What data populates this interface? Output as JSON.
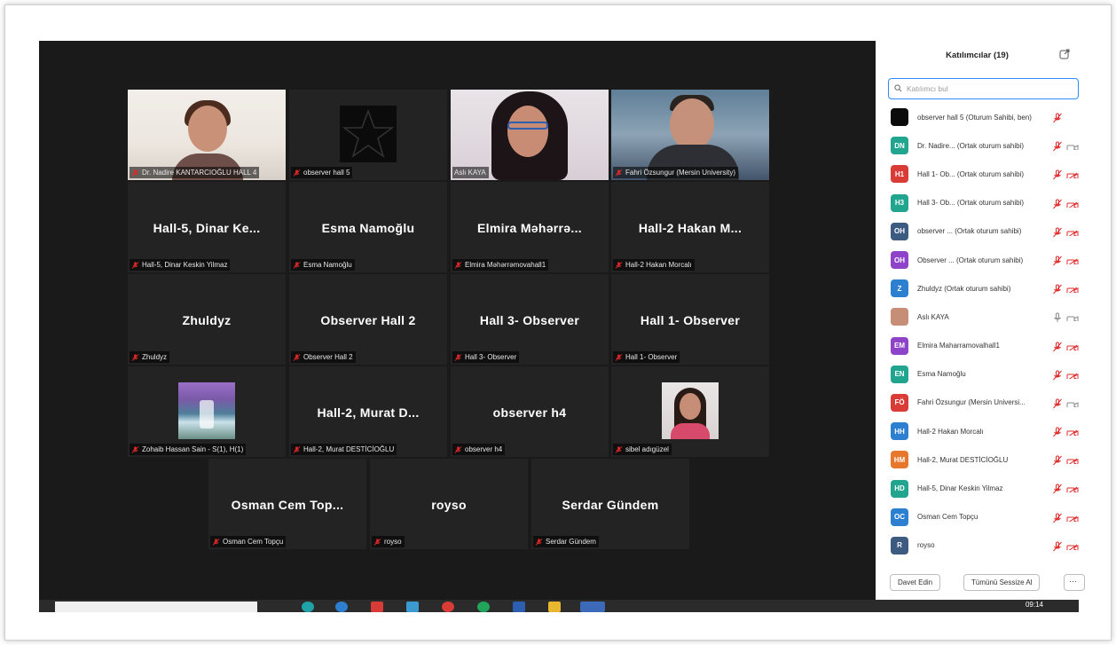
{
  "colors": {
    "video_bg": "#1a1a1a",
    "tile_bg": "#232323",
    "active_speaker": "#c7d33a",
    "muted_red": "#e02828",
    "accent_blue": "#2d8cff"
  },
  "video_tiles": [
    {
      "label": "Dr. Nadire KANTARCIOĞLU HALL 4",
      "big_name": "",
      "kind": "photo1"
    },
    {
      "label": "observer hall 5",
      "big_name": "",
      "kind": "star"
    },
    {
      "label": "Aslı KAYA",
      "big_name": "",
      "kind": "photo3"
    },
    {
      "label": "Fahri Özsungur (Mersin University)",
      "big_name": "",
      "kind": "photo4",
      "active": true
    },
    {
      "label": "Hall-5, Dinar Keskin Yilmaz",
      "big_name": "Hall-5, Dinar Ke..."
    },
    {
      "label": "Esma Namoğlu",
      "big_name": "Esma Namoğlu"
    },
    {
      "label": "Elmira Məhərrəmovahall1",
      "big_name": "Elmira Məhərrə..."
    },
    {
      "label": "Hall-2 Hakan Morcalı",
      "big_name": "Hall-2 Hakan M..."
    },
    {
      "label": "Zhuldyz",
      "big_name": "Zhuldyz"
    },
    {
      "label": "Observer Hall 2",
      "big_name": "Observer Hall 2"
    },
    {
      "label": "Hall 3- Observer",
      "big_name": "Hall 3- Observer"
    },
    {
      "label": "Hall 1- Observer",
      "big_name": "Hall 1- Observer"
    },
    {
      "label": "Zohaib Hassan Sain - S(1), H(1)",
      "big_name": "",
      "kind": "waterfall"
    },
    {
      "label": "Hall-2, Murat DESTİCİOĞLU",
      "big_name": "Hall-2, Murat D..."
    },
    {
      "label": "observer h4",
      "big_name": "observer h4"
    },
    {
      "label": "sibel adıgüzel",
      "big_name": "",
      "kind": "avatar"
    },
    {
      "label": "Osman Cem Topçu",
      "big_name": "Osman Cem Top..."
    },
    {
      "label": "roysо",
      "big_name": "royso"
    },
    {
      "label": "Serdar Gündem",
      "big_name": "Serdar Gündem"
    }
  ],
  "panel": {
    "title": "Katılımcılar (19)",
    "search_placeholder": "Katılımcı bul",
    "participants": [
      {
        "initials": "",
        "color": "#0b0b0b",
        "name": "observer hall 5 (Oturum Sahibi, ben)",
        "mic": "muted",
        "cam": "none"
      },
      {
        "initials": "DN",
        "color": "#21a58f",
        "name": "Dr. Nadire... (Ortak oturum sahibi)",
        "mic": "muted",
        "cam": "on"
      },
      {
        "initials": "H1",
        "color": "#d93b36",
        "name": "Hall 1- Ob... (Ortak oturum sahibi)",
        "mic": "muted",
        "cam": "off"
      },
      {
        "initials": "H3",
        "color": "#21a58f",
        "name": "Hall 3- Ob... (Ortak oturum sahibi)",
        "mic": "muted",
        "cam": "off"
      },
      {
        "initials": "OH",
        "color": "#3d5a80",
        "name": "observer ... (Ortak oturum sahibi)",
        "mic": "muted",
        "cam": "off"
      },
      {
        "initials": "OH",
        "color": "#8e44c8",
        "name": "Observer ... (Ortak oturum sahibi)",
        "mic": "muted",
        "cam": "off"
      },
      {
        "initials": "Z",
        "color": "#2d7fd0",
        "name": "Zhuldyz (Ortak oturum sahibi)",
        "mic": "muted",
        "cam": "off"
      },
      {
        "initials": "",
        "color": "#c68e76",
        "name": "Aslı KAYA",
        "mic": "on",
        "cam": "on"
      },
      {
        "initials": "EM",
        "color": "#8e44c8",
        "name": "Elmira Maharramovalhall1",
        "mic": "muted",
        "cam": "off"
      },
      {
        "initials": "EN",
        "color": "#21a58f",
        "name": "Esma Namoğlu",
        "mic": "muted",
        "cam": "off"
      },
      {
        "initials": "FÖ",
        "color": "#d93b36",
        "name": "Fahri Özsungur (Mersin Universi...",
        "mic": "muted",
        "cam": "on"
      },
      {
        "initials": "HH",
        "color": "#2d7fd0",
        "name": "Hall-2 Hakan Morcalı",
        "mic": "muted",
        "cam": "off"
      },
      {
        "initials": "HM",
        "color": "#e8772e",
        "name": "Hall-2, Murat DESTİCİOĞLU",
        "mic": "muted",
        "cam": "off"
      },
      {
        "initials": "HD",
        "color": "#21a58f",
        "name": "Hall-5, Dinar Keskin Yilmaz",
        "mic": "muted",
        "cam": "off"
      },
      {
        "initials": "OC",
        "color": "#2d7fd0",
        "name": "Osman Cem Topçu",
        "mic": "muted",
        "cam": "off"
      },
      {
        "initials": "R",
        "color": "#3d5a80",
        "name": "royso",
        "mic": "muted",
        "cam": "off"
      }
    ],
    "invite_label": "Davet Edin",
    "mute_all_label": "Tümünü Sessize Al",
    "more_label": "···"
  },
  "taskbar": {
    "clock": "09:14"
  }
}
